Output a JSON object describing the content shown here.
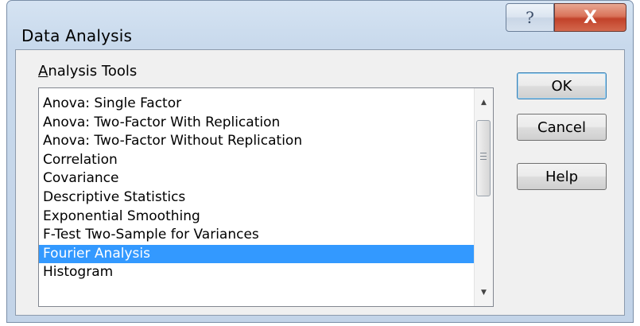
{
  "window": {
    "title": "Data Analysis",
    "help_glyph": "?",
    "close_glyph": "X"
  },
  "analysis_tools": {
    "label_first": "A",
    "label_rest": "nalysis Tools",
    "items": [
      "Anova: Single Factor",
      "Anova: Two-Factor With Replication",
      "Anova: Two-Factor Without Replication",
      "Correlation",
      "Covariance",
      "Descriptive Statistics",
      "Exponential Smoothing",
      "F-Test Two-Sample for Variances",
      "Fourier Analysis",
      "Histogram"
    ],
    "selected": "Fourier Analysis"
  },
  "buttons": {
    "ok": "OK",
    "cancel": "Cancel",
    "help_first": "H",
    "help_rest": "elp"
  },
  "icons": {
    "scroll_up": "scroll-up-arrow-icon",
    "scroll_down": "scroll-down-arrow-icon",
    "help": "question-mark-icon",
    "close": "close-x-icon"
  },
  "colors": {
    "selection": "#3399ff",
    "close_button": "#c2422a"
  }
}
